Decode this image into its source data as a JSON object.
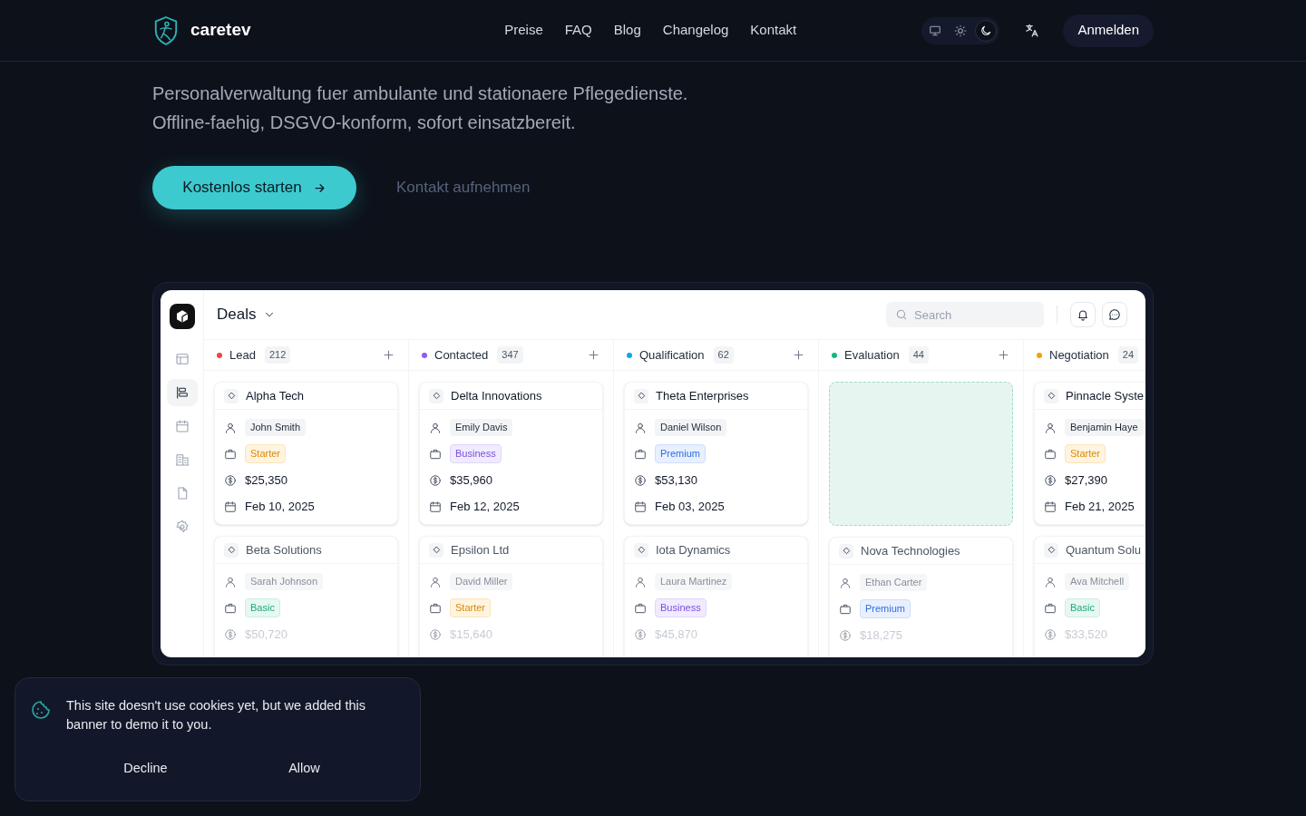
{
  "header": {
    "brand": "caretev",
    "nav": [
      "Preise",
      "FAQ",
      "Blog",
      "Changelog",
      "Kontakt"
    ],
    "theme_switcher": [
      {
        "kind": "system",
        "selected": false
      },
      {
        "kind": "light",
        "selected": false
      },
      {
        "kind": "dark",
        "selected": true
      }
    ],
    "login_button": "Anmelden"
  },
  "hero": {
    "lines": [
      "Personalverwaltung fuer ambulante und stationaere Pflegedienste.",
      "Offline-faehig, DSGVO-konform, sofort einsatzbereit."
    ],
    "primary_button": "Kostenlos starten",
    "secondary_link": "Kontakt aufnehmen"
  },
  "app": {
    "title": "Deals",
    "search": {
      "placeholder": "Search"
    },
    "sidebar": [
      {
        "kind": "layout",
        "selected": false
      },
      {
        "kind": "kanban",
        "selected": true
      },
      {
        "kind": "calendar",
        "selected": false
      },
      {
        "kind": "building",
        "selected": false
      },
      {
        "kind": "file",
        "selected": false
      },
      {
        "kind": "settings",
        "selected": false
      }
    ],
    "columns": [
      {
        "name": "Lead",
        "count": "212",
        "color": "#ef4444",
        "cards": [
          {
            "kind": "deal",
            "faded": false,
            "company": "Alpha Tech",
            "contact": "John Smith",
            "plan": "Starter",
            "color": "#d98a0b",
            "amount": "$25,350",
            "date": "Feb 10, 2025"
          },
          {
            "kind": "deal",
            "faded": true,
            "company": "Beta Solutions",
            "contact": "Sarah Johnson",
            "plan": "Basic",
            "color": "#1fa877",
            "amount": "$50,720"
          }
        ]
      },
      {
        "name": "Contacted",
        "count": "347",
        "color": "#8b5cf6",
        "cards": [
          {
            "kind": "deal",
            "faded": false,
            "company": "Delta Innovations",
            "contact": "Emily Davis",
            "plan": "Business",
            "color": "#7c4ddb",
            "amount": "$35,960",
            "date": "Feb 12, 2025"
          },
          {
            "kind": "deal",
            "faded": true,
            "company": "Epsilon Ltd",
            "contact": "David Miller",
            "plan": "Starter",
            "color": "#d98a0b",
            "amount": "$15,640"
          }
        ]
      },
      {
        "name": "Qualification",
        "count": "62",
        "color": "#0ea5e9",
        "cards": [
          {
            "kind": "deal",
            "faded": false,
            "company": "Theta Enterprises",
            "contact": "Daniel Wilson",
            "plan": "Premium",
            "color": "#2f6ee0",
            "amount": "$53,130",
            "date": "Feb 03, 2025"
          },
          {
            "kind": "deal",
            "faded": true,
            "company": "Iota Dynamics",
            "contact": "Laura Martinez",
            "plan": "Business",
            "color": "#7c4ddb",
            "amount": "$45,870"
          }
        ]
      },
      {
        "name": "Evaluation",
        "count": "44",
        "color": "#10b981",
        "cards": [
          {
            "kind": "dropzone"
          },
          {
            "kind": "deal",
            "faded": true,
            "company": "Nova Technologies",
            "contact": "Ethan Carter",
            "plan": "Premium",
            "color": "#2f6ee0",
            "amount": "$18,275"
          }
        ]
      },
      {
        "name": "Negotiation",
        "count": "24",
        "color": "#f59e0b",
        "cards": [
          {
            "kind": "deal",
            "faded": false,
            "company": "Pinnacle Syste",
            "contact": "Benjamin Haye",
            "plan": "Starter",
            "color": "#d98a0b",
            "amount": "$27,390",
            "date": "Feb 21, 2025"
          },
          {
            "kind": "deal",
            "faded": true,
            "company": "Quantum Solu",
            "contact": "Ava Mitchell",
            "plan": "Basic",
            "color": "#1fa877",
            "amount": "$33,520"
          }
        ]
      }
    ]
  },
  "cookie_banner": {
    "text": "This site doesn't use cookies yet, but we added this banner to demo it to you.",
    "buttons": [
      "Decline",
      "Allow"
    ]
  }
}
